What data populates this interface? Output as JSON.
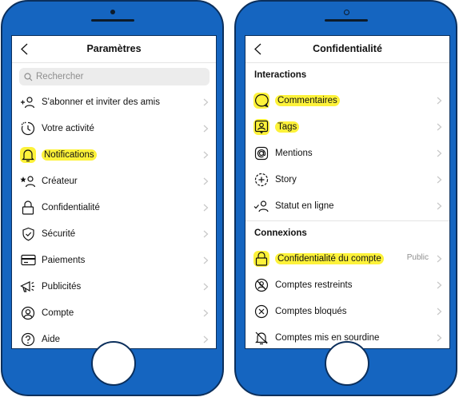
{
  "left_screen": {
    "title": "Paramètres",
    "search_placeholder": "Rechercher",
    "items": [
      {
        "label": "S'abonner et inviter des amis"
      },
      {
        "label": "Votre activité"
      },
      {
        "label": "Notifications"
      },
      {
        "label": "Créateur"
      },
      {
        "label": "Confidentialité"
      },
      {
        "label": "Sécurité"
      },
      {
        "label": "Paiements"
      },
      {
        "label": "Publicités"
      },
      {
        "label": "Compte"
      },
      {
        "label": "Aide"
      }
    ]
  },
  "right_screen": {
    "title": "Confidentialité",
    "sections": [
      {
        "title": "Interactions",
        "items": [
          {
            "label": "Commentaires"
          },
          {
            "label": "Tags"
          },
          {
            "label": "Mentions"
          },
          {
            "label": "Story"
          },
          {
            "label": "Statut en ligne"
          }
        ]
      },
      {
        "title": "Connexions",
        "items": [
          {
            "label": "Confidentialité du compte",
            "value": "Public"
          },
          {
            "label": "Comptes restreints"
          },
          {
            "label": "Comptes bloqués"
          },
          {
            "label": "Comptes mis en sourdine"
          }
        ]
      }
    ]
  },
  "icons": {
    "left": [
      "add-person-icon",
      "activity-icon",
      "bell-icon",
      "creator-icon",
      "lock-icon",
      "shield-icon",
      "card-icon",
      "megaphone-icon",
      "account-icon",
      "help-icon"
    ],
    "right": [
      "comment-icon",
      "tag-icon",
      "mention-icon",
      "story-add-icon",
      "online-status-icon",
      "lock-icon",
      "restricted-icon",
      "blocked-icon",
      "muted-icon"
    ]
  },
  "colors": {
    "device": "#1565c0",
    "highlight": "#fdf23a",
    "text": "#111111",
    "muted": "#8e8e8e"
  }
}
